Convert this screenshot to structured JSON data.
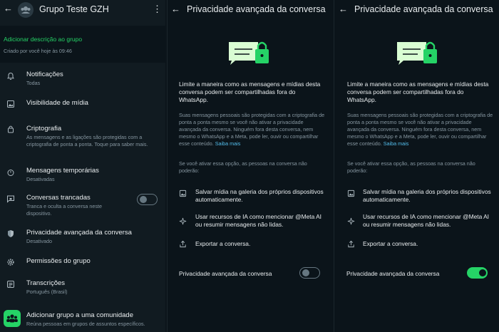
{
  "group": {
    "title": "Grupo Teste GZH",
    "add_description": "Adicionar descrição ao grupo",
    "created": "Criado por você hoje às 09:46"
  },
  "settings": {
    "notifications": {
      "label": "Notificações",
      "value": "Todas"
    },
    "media_visibility": {
      "label": "Visibilidade de mídia"
    },
    "encryption": {
      "label": "Criptografia",
      "desc": "As mensagens e as ligações são protegidas com a criptografia de ponta a ponta. Toque para saber mais."
    },
    "temporary": {
      "label": "Mensagens temporárias",
      "value": "Desativadas"
    },
    "locked": {
      "label": "Conversas trancadas",
      "desc": "Tranca e oculta a conversa neste dispositivo.",
      "enabled": false
    },
    "advanced_privacy": {
      "label": "Privacidade avançada da conversa",
      "value": "Desativado"
    },
    "permissions": {
      "label": "Permissões do grupo"
    },
    "transcripts": {
      "label": "Transcrições",
      "value": "Português (Brasil)"
    },
    "community": {
      "label": "Adicionar grupo a uma comunidade",
      "desc": "Reúna pessoas em grupos de assuntos específicos."
    }
  },
  "privacy": {
    "title": "Privacidade avançada da conversa",
    "lead": "Limite a maneira como as mensagens e mídias desta conversa podem ser compartilhadas fora do WhatsApp.",
    "body": "Suas mensagens pessoais são protegidas com a criptografia de ponta a ponta mesmo se você não ativar a privacidade avançada da conversa. Ninguém fora desta conversa, nem mesmo o WhatsApp e a Meta, pode ler, ouvir ou compartilhar esse conteúdo.",
    "learn_more": "Saiba mais",
    "if_enabled": "Se você ativar essa opção, as pessoas na conversa não poderão:",
    "features": [
      "Salvar mídia na galeria dos próprios dispositivos automaticamente.",
      "Usar recursos de IA como mencionar @Meta AI ou resumir mensagens não lidas.",
      "Exportar a conversa."
    ],
    "toggle_label": "Privacidade avançada da conversa",
    "states": [
      false,
      true
    ]
  },
  "colors": {
    "accent": "#25d366",
    "background": "#0b141a",
    "secondary": "#8696a0",
    "link": "#53bdeb"
  }
}
